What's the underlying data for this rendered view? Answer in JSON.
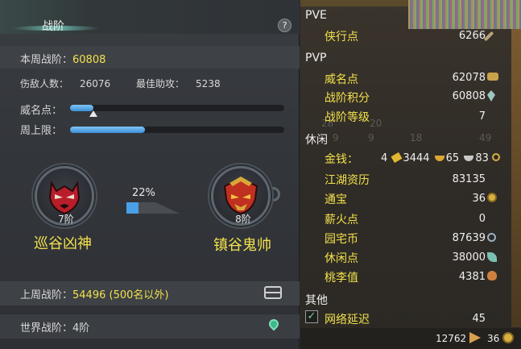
{
  "left_panel": {
    "title": "战阶",
    "help": "?",
    "weekly_label": "本周战阶：",
    "weekly_value": "60808",
    "injured_label": "伤敌人数：",
    "injured_value": "26076",
    "assist_label": "最佳助攻：",
    "assist_value": "5238",
    "fame_label": "威名点：",
    "fame_progress": 0.11,
    "week_cap_label": "周上限：",
    "week_cap_progress": 0.35,
    "current_rank": {
      "tier": "7阶",
      "name": "巡谷凶神"
    },
    "next_rank": {
      "tier": "8阶",
      "name": "镇谷鬼帅"
    },
    "progress_pct": "22%",
    "progress_fraction": 0.22,
    "last_week_label": "上周战阶：",
    "last_week_value": "54496 (500名以外)",
    "world_rank": "世界战阶：4阶",
    "icons": {
      "chest": "treasure-chest-icon",
      "location": "location-pin-icon"
    }
  },
  "right_panel": {
    "sections": {
      "pve": "PVE",
      "pvp": "PVP",
      "leisure": "休闲",
      "other": "其他"
    },
    "pve_items": [
      {
        "label": "侠行点",
        "value": "6266",
        "icon": "sword-icon",
        "color": "#b5a27a"
      }
    ],
    "pvp_items": [
      {
        "label": "威名点",
        "value": "62078",
        "icon": "mask-icon",
        "color": "#c9a34a"
      },
      {
        "label": "战阶积分",
        "value": "60808",
        "icon": "crystal-icon",
        "color": "#9ac8c0"
      },
      {
        "label": "战阶等级",
        "value": "7",
        "icon": "",
        "color": ""
      }
    ],
    "money_label": "金钱：",
    "money_values": [
      "4",
      "3444",
      "65",
      "83"
    ],
    "leisure_items": [
      {
        "label": "江湖资历",
        "value": "83135",
        "icon": "",
        "color": ""
      },
      {
        "label": "通宝",
        "value": "36",
        "icon": "coin-icon",
        "color": "#d8b040"
      },
      {
        "label": "薪火点",
        "value": "0",
        "icon": "",
        "color": ""
      },
      {
        "label": "园宅币",
        "value": "87639",
        "icon": "house-coin-icon",
        "color": "#9ab0c0"
      },
      {
        "label": "休闲点",
        "value": "38000",
        "icon": "leaf-icon",
        "color": "#7ac0b0"
      },
      {
        "label": "桃李值",
        "value": "4381",
        "icon": "peach-icon",
        "color": "#d08040"
      }
    ],
    "network_label": "网络延迟",
    "network_value": "45",
    "faint_numbers": [
      "9",
      "9",
      "18",
      "49",
      "28",
      "20"
    ],
    "footer_value": "12762",
    "footer_coin": "36"
  }
}
